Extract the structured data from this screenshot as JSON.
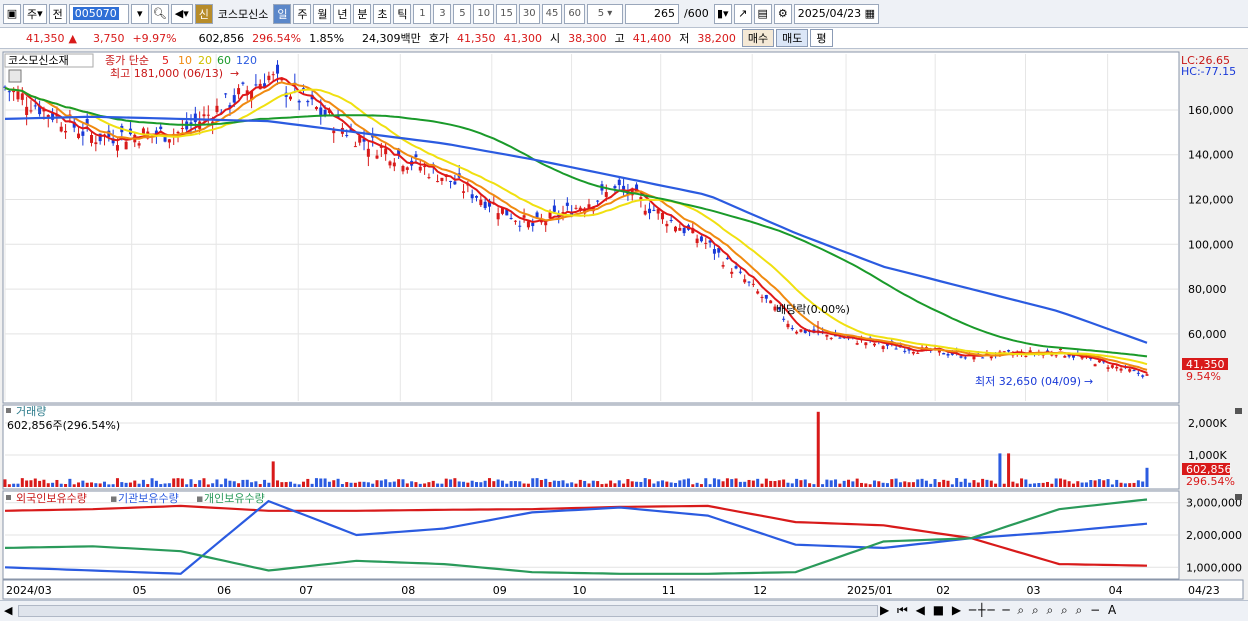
{
  "toolbar": {
    "period_label": "주",
    "prev_label": "전",
    "code": "005070",
    "sin_label": "신",
    "stock_name": "코스모신소",
    "intervals": [
      "일",
      "주",
      "월",
      "년",
      "분",
      "초",
      "틱"
    ],
    "active_interval": "일",
    "numbers": [
      "1",
      "3",
      "5",
      "10",
      "15",
      "30",
      "45",
      "60"
    ],
    "num_select": "5",
    "count": "265",
    "count_total": "/600",
    "date": "2025/04/23"
  },
  "info": {
    "price": "41,350",
    "change": "3,750",
    "pct": "+9.97%",
    "volume": "602,856",
    "vol_pct": "296.54%",
    "turnover": "1.85%",
    "amount": "24,309백만",
    "quote_label": "호가",
    "ask": "41,350",
    "bid": "41,300",
    "open_label": "시",
    "open": "38,300",
    "high_label": "고",
    "high": "41,400",
    "low_label": "저",
    "low": "38,200",
    "buy": "매수",
    "sell": "매도",
    "eval": "평"
  },
  "price_pane": {
    "stock_label": "코스모신소재",
    "ma_label": "종가 단순",
    "ma_periods": [
      "5",
      "10",
      "20",
      "60",
      "120"
    ],
    "ma_colors": [
      "#e01818",
      "#f08a10",
      "#f0e010",
      "#1a9a2a",
      "#2b5be0"
    ],
    "high_note": "최고 181,000 (06/13)",
    "low_note": "최저 32,650 (04/09)",
    "dividend_note": "배당락(0.00%)",
    "lc": "LC:26.65",
    "hc": "HC:-77.15",
    "last_price": "41,350",
    "last_pct": "9.54%",
    "y_ticks": [
      "160,000",
      "140,000",
      "120,000",
      "100,000",
      "80,000",
      "60,000"
    ]
  },
  "volume_pane": {
    "title": "거래량",
    "value": "602,856주(296.54%)",
    "y_ticks": [
      "2,000K",
      "1,000K"
    ],
    "last": "602,856",
    "last_pct": "296.54%"
  },
  "holding_pane": {
    "series": [
      "외국인보유수량",
      "기관보유수량",
      "개인보유수량"
    ],
    "colors": [
      "#d81a1a",
      "#2b5be0",
      "#2a9a5a"
    ],
    "y_ticks": [
      "3,000,000",
      "2,000,000",
      "1,000,000"
    ]
  },
  "x_axis": [
    "2024/03",
    "05",
    "06",
    "07",
    "08",
    "09",
    "10",
    "11",
    "12",
    "2025/01",
    "02",
    "03",
    "04"
  ],
  "x_right": "04/23",
  "chart_data": {
    "type": "line",
    "x": [
      "2024/03",
      "04",
      "05",
      "06",
      "07",
      "08",
      "09",
      "10",
      "11",
      "12",
      "2025/01",
      "02",
      "03",
      "04"
    ],
    "series": [
      {
        "name": "종가",
        "values": [
          170000,
          148000,
          150000,
          175000,
          148000,
          130000,
          108000,
          125000,
          100000,
          62000,
          55000,
          50000,
          52000,
          41350
        ]
      },
      {
        "name": "120",
        "values": [
          156000,
          157000,
          156000,
          155000,
          150000,
          145000,
          138000,
          130000,
          122000,
          105000,
          90000,
          80000,
          70000,
          56000
        ]
      },
      {
        "name": "외국인보유수량",
        "values": [
          2750000,
          2800000,
          2900000,
          2750000,
          2750000,
          2780000,
          2800000,
          2870000,
          2900000,
          2400000,
          2300000,
          1900000,
          1100000,
          1050000
        ]
      },
      {
        "name": "기관보유수량",
        "values": [
          1000000,
          900000,
          800000,
          3050000,
          2000000,
          2200000,
          2700000,
          2850000,
          2600000,
          1700000,
          1600000,
          1900000,
          2100000,
          2350000
        ]
      },
      {
        "name": "개인보유수량",
        "values": [
          1600000,
          1650000,
          1500000,
          900000,
          1200000,
          1100000,
          850000,
          800000,
          800000,
          850000,
          1800000,
          1900000,
          2800000,
          3100000
        ]
      }
    ]
  }
}
